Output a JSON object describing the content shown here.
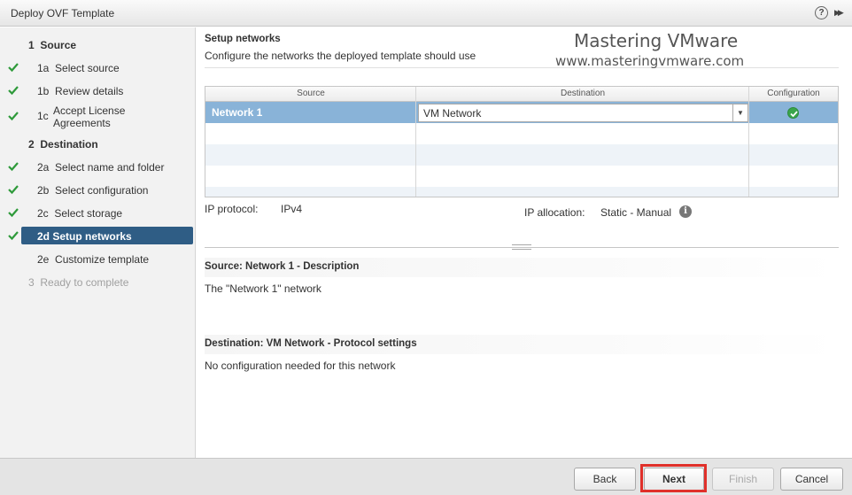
{
  "window": {
    "title": "Deploy OVF Template",
    "help_glyph": "?",
    "expand_glyph": "▶▶"
  },
  "sidebar": {
    "steps": [
      {
        "num": "1",
        "label": "Source",
        "type": "header",
        "checked": false
      },
      {
        "num": "1a",
        "label": "Select source",
        "type": "sub",
        "checked": true
      },
      {
        "num": "1b",
        "label": "Review details",
        "type": "sub",
        "checked": true
      },
      {
        "num": "1c",
        "label": "Accept License Agreements",
        "type": "sub",
        "checked": true
      },
      {
        "num": "2",
        "label": "Destination",
        "type": "header",
        "checked": false
      },
      {
        "num": "2a",
        "label": "Select name and folder",
        "type": "sub",
        "checked": true
      },
      {
        "num": "2b",
        "label": "Select configuration",
        "type": "sub",
        "checked": true
      },
      {
        "num": "2c",
        "label": "Select storage",
        "type": "sub",
        "checked": true
      },
      {
        "num": "2d",
        "label": "Setup networks",
        "type": "sub",
        "checked": true,
        "active": true
      },
      {
        "num": "2e",
        "label": "Customize template",
        "type": "sub",
        "checked": false
      },
      {
        "num": "3",
        "label": "Ready to complete",
        "type": "header",
        "checked": false,
        "disabled": true
      }
    ]
  },
  "main": {
    "title": "Setup networks",
    "subtitle": "Configure the networks the deployed template should use",
    "watermark_title": "Mastering VMware",
    "watermark_url": "www.masteringvmware.com",
    "grid": {
      "columns": [
        "Source",
        "Destination",
        "Configuration"
      ],
      "rows": [
        {
          "source": "Network 1",
          "destination": "VM Network",
          "status": "ok"
        }
      ]
    },
    "ip_protocol_label": "IP protocol:",
    "ip_protocol_value": "IPv4",
    "ip_allocation_label": "IP allocation:",
    "ip_allocation_value": "Static - Manual",
    "source_section_title": "Source: Network 1 - Description",
    "source_section_body": "The \"Network 1\" network",
    "dest_section_title": "Destination: VM Network - Protocol settings",
    "dest_section_body": "No configuration needed for this network"
  },
  "footer": {
    "back": "Back",
    "next": "Next",
    "finish": "Finish",
    "cancel": "Cancel"
  },
  "colors": {
    "active_step": "#2f5d85",
    "selected_row": "#89b3d8",
    "check": "#2e9a3a",
    "highlight_box": "#e0302a"
  }
}
